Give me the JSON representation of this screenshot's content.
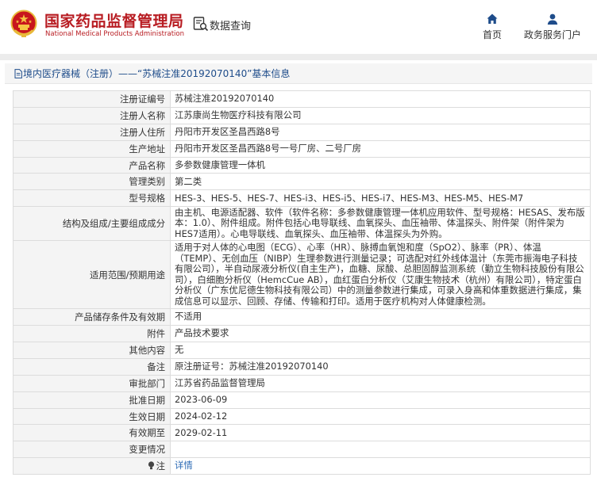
{
  "header": {
    "org_name_cn": "国家药品监督管理局",
    "org_name_en": "National Medical Products Administration",
    "query_label": "数据查询",
    "nav_home": "首页",
    "nav_portal": "政务服务门户"
  },
  "breadcrumb": "境内医疗器械（注册）——“苏械注准20192070140”基本信息",
  "fields": [
    {
      "label": "注册证编号",
      "value": "苏械注准20192070140"
    },
    {
      "label": "注册人名称",
      "value": "江苏康尚生物医疗科技有限公司"
    },
    {
      "label": "注册人住所",
      "value": "丹阳市开发区圣昌西路8号"
    },
    {
      "label": "生产地址",
      "value": "丹阳市开发区圣昌西路8号一号厂房、二号厂房"
    },
    {
      "label": "产品名称",
      "value": "多参数健康管理一体机"
    },
    {
      "label": "管理类别",
      "value": "第二类"
    },
    {
      "label": "型号规格",
      "value": "HES-3、HES-5、HES-7、HES-i3、HES-i5、HES-i7、HES-M3、HES-M5、HES-M7"
    },
    {
      "label": "结构及组成/主要组成成分",
      "value": "由主机、电源适配器、软件（软件名称：多参数健康管理一体机应用软件、型号规格：HESAS、发布版本：1.0）、附件组成。附件包括心电导联线、血氧探头、血压袖带、体温探头、附件架（附件架为HES7适用）。心电导联线、血氧探头、血压袖带、体温探头为外购。"
    },
    {
      "label": "适用范围/预期用途",
      "value": "适用于对人体的心电图（ECG）、心率（HR）、脉搏血氧饱和度（SpO2）、脉率（PR）、体温（TEMP）、无创血压（NIBP）生理参数进行测量记录；可选配对红外线体温计（东莞市振海电子科技有限公司），半自动尿液分析仪(自主生产)，血糖、尿酸、总胆固醇监测系统（勤立生物科技股份有限公司），白细胞分析仪（HemcCue AB），血红蛋白分析仪（艾康生物技术（杭州）有限公司），特定蛋白分析仪（广东优尼德生物科技有限公司）中的测量参数进行集成，可录入身高和体重数据进行集成，集成信息可以显示、回顾、存储、传输和打印。适用于医疗机构对人体健康检测。"
    },
    {
      "label": "产品储存条件及有效期",
      "value": "不适用"
    },
    {
      "label": "附件",
      "value": "产品技术要求"
    },
    {
      "label": "其他内容",
      "value": "无"
    },
    {
      "label": "备注",
      "value": "原注册证号：苏械注准20192070140"
    },
    {
      "label": "审批部门",
      "value": "江苏省药品监督管理局"
    },
    {
      "label": "批准日期",
      "value": "2023-06-09"
    },
    {
      "label": "生效日期",
      "value": "2024-02-12"
    },
    {
      "label": "有效期至",
      "value": "2029-02-11"
    },
    {
      "label": "变更情况",
      "value": ""
    },
    {
      "label": "注",
      "value": "详情"
    }
  ],
  "colors": {
    "brand_red": "#b81c22",
    "link_blue": "#2c6bb5",
    "breadcrumb_blue": "#1e4c8a",
    "key_bg": "#f4f4f4",
    "border": "#dcdcdc"
  },
  "icons": {
    "emblem": "national-emblem-icon",
    "query": "data-query-icon",
    "home": "home-icon",
    "portal": "user-icon",
    "breadcrumb": "document-icon",
    "note": "lightbulb-icon"
  }
}
